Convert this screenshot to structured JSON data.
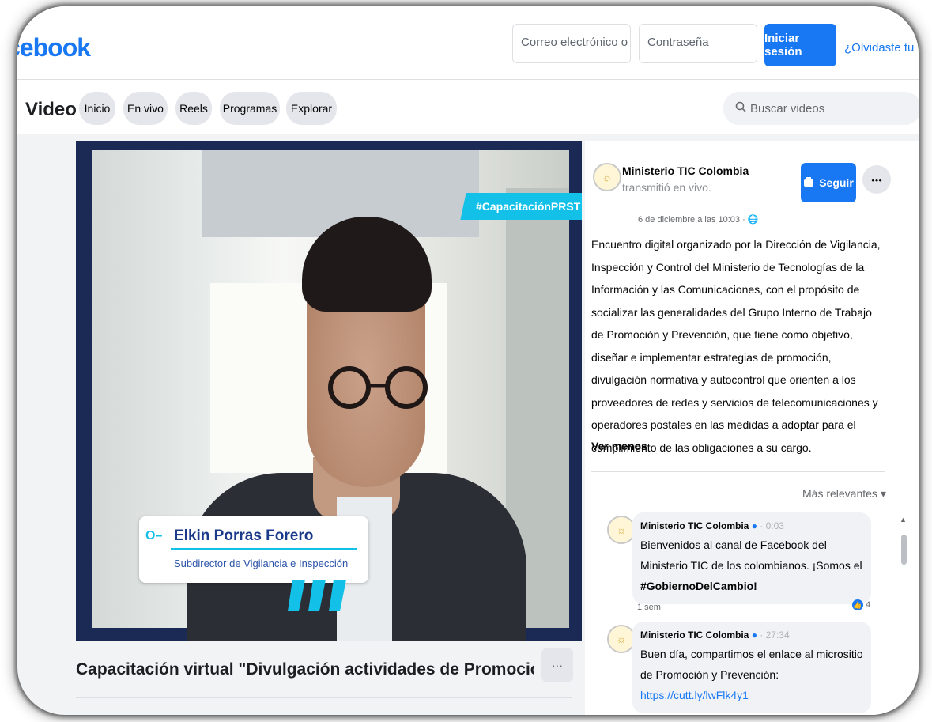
{
  "topbar": {
    "logo": "cebook",
    "email_placeholder": "Correo electrónico o tel",
    "password_placeholder": "Contraseña",
    "login_label": "Iniciar sesión",
    "forgot_label": "¿Olvidaste tu"
  },
  "videobar": {
    "title": "Video",
    "tabs": [
      {
        "label": "Inicio"
      },
      {
        "label": "En vivo"
      },
      {
        "label": "Reels"
      },
      {
        "label": "Programas"
      },
      {
        "label": "Explorar"
      }
    ],
    "search_placeholder": "Buscar videos"
  },
  "player": {
    "hashtag": "#CapacitaciónPRST",
    "speaker_name": "Elkin Porras Forero",
    "speaker_role": "Subdirector de Vigilancia e Inspección"
  },
  "video_title": "Capacitación virtual \"Divulgación actividades de Promoción y Prevenció...",
  "post": {
    "page_name": "Ministerio TIC Colombia",
    "action_text": "transmitió en vivo.",
    "date": "6 de diciembre a las 10:03 ·",
    "follow_label": "Seguir",
    "description": "Encuentro digital organizado por la Dirección de Vigilancia, Inspección y Control del Ministerio de Tecnologías de la Información y las Comunicaciones, con el propósito de socializar las generalidades del Grupo Interno de Trabajo de Promoción y Prevención, que tiene como objetivo, diseñar e implementar estrategias de promoción, divulgación normativa y autocontrol que orienten a los proveedores de redes y servicios de telecomunicaciones y operadores postales en las medidas a adoptar para el cumplimiento de las obligaciones a su cargo.",
    "see_less": "Ver menos"
  },
  "comments": {
    "sort_label": "Más relevantes ▾",
    "items": [
      {
        "author": "Ministerio TIC Colombia",
        "time": "· 0:03",
        "text_plain": "Bienvenidos al canal de Facebook del Ministerio TIC de los colombianos. ¡Somos el ",
        "text_bold": "#GobiernoDelCambio!",
        "meta": "1 sem",
        "reaction_count": "4"
      },
      {
        "author": "Ministerio TIC Colombia",
        "time": "· 27:34",
        "text_plain": "Buen día, compartimos el enlace al micrositio de Promoción y Prevención: ",
        "link": "https://cutt.ly/lwFlk4y1"
      }
    ]
  }
}
